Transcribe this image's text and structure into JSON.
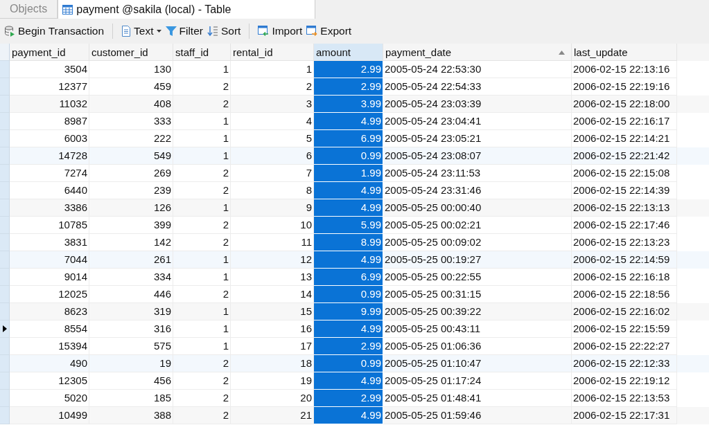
{
  "tabs": [
    {
      "label": "Objects",
      "selected": false,
      "kind": "objects"
    },
    {
      "label": "payment @sakila (local) - Table",
      "selected": true,
      "kind": "table"
    }
  ],
  "toolbar": [
    {
      "label": "Begin Transaction",
      "kind": "transaction"
    },
    {
      "label": "Text",
      "kind": "text"
    },
    {
      "label": "Filter",
      "kind": "filter"
    },
    {
      "label": "Sort",
      "kind": "sort"
    },
    {
      "label": "Import",
      "kind": "import"
    },
    {
      "label": "Export",
      "kind": "export"
    }
  ],
  "table": {
    "columns": [
      {
        "name": "payment_id",
        "kind": "number",
        "selected": false,
        "sorted": false
      },
      {
        "name": "customer_id",
        "kind": "number",
        "selected": false,
        "sorted": false
      },
      {
        "name": "staff_id",
        "kind": "number",
        "selected": false,
        "sorted": false
      },
      {
        "name": "rental_id",
        "kind": "number",
        "selected": false,
        "sorted": false
      },
      {
        "name": "amount",
        "kind": "number",
        "selected": true,
        "sorted": false
      },
      {
        "name": "payment_date",
        "kind": "datetime",
        "selected": false,
        "sorted": true
      },
      {
        "name": "last_update",
        "kind": "datetime",
        "selected": false,
        "sorted": false
      }
    ],
    "rows": [
      {
        "current": false,
        "cells": [
          "3504",
          "130",
          "1",
          "1",
          "2.99",
          "2005-05-24 22:53:30",
          "2006-02-15 22:13:16"
        ]
      },
      {
        "current": false,
        "cells": [
          "12377",
          "459",
          "2",
          "2",
          "2.99",
          "2005-05-24 22:54:33",
          "2006-02-15 22:19:16"
        ]
      },
      {
        "current": false,
        "cells": [
          "11032",
          "408",
          "2",
          "3",
          "3.99",
          "2005-05-24 23:03:39",
          "2006-02-15 22:18:00"
        ]
      },
      {
        "current": false,
        "cells": [
          "8987",
          "333",
          "1",
          "4",
          "4.99",
          "2005-05-24 23:04:41",
          "2006-02-15 22:16:17"
        ]
      },
      {
        "current": false,
        "cells": [
          "6003",
          "222",
          "1",
          "5",
          "6.99",
          "2005-05-24 23:05:21",
          "2006-02-15 22:14:21"
        ]
      },
      {
        "current": false,
        "cells": [
          "14728",
          "549",
          "1",
          "6",
          "0.99",
          "2005-05-24 23:08:07",
          "2006-02-15 22:21:42"
        ]
      },
      {
        "current": false,
        "cells": [
          "7274",
          "269",
          "2",
          "7",
          "1.99",
          "2005-05-24 23:11:53",
          "2006-02-15 22:15:08"
        ]
      },
      {
        "current": false,
        "cells": [
          "6440",
          "239",
          "2",
          "8",
          "4.99",
          "2005-05-24 23:31:46",
          "2006-02-15 22:14:39"
        ]
      },
      {
        "current": false,
        "cells": [
          "3386",
          "126",
          "1",
          "9",
          "4.99",
          "2005-05-25 00:00:40",
          "2006-02-15 22:13:13"
        ]
      },
      {
        "current": false,
        "cells": [
          "10785",
          "399",
          "2",
          "10",
          "5.99",
          "2005-05-25 00:02:21",
          "2006-02-15 22:17:46"
        ]
      },
      {
        "current": false,
        "cells": [
          "3831",
          "142",
          "2",
          "11",
          "8.99",
          "2005-05-25 00:09:02",
          "2006-02-15 22:13:23"
        ]
      },
      {
        "current": false,
        "cells": [
          "7044",
          "261",
          "1",
          "12",
          "4.99",
          "2005-05-25 00:19:27",
          "2006-02-15 22:14:59"
        ]
      },
      {
        "current": false,
        "cells": [
          "9014",
          "334",
          "1",
          "13",
          "6.99",
          "2005-05-25 00:22:55",
          "2006-02-15 22:16:18"
        ]
      },
      {
        "current": false,
        "cells": [
          "12025",
          "446",
          "2",
          "14",
          "0.99",
          "2005-05-25 00:31:15",
          "2006-02-15 22:18:56"
        ]
      },
      {
        "current": false,
        "cells": [
          "8623",
          "319",
          "1",
          "15",
          "9.99",
          "2005-05-25 00:39:22",
          "2006-02-15 22:16:02"
        ]
      },
      {
        "current": true,
        "cells": [
          "8554",
          "316",
          "1",
          "16",
          "4.99",
          "2005-05-25 00:43:11",
          "2006-02-15 22:15:59"
        ]
      },
      {
        "current": false,
        "cells": [
          "15394",
          "575",
          "1",
          "17",
          "2.99",
          "2005-05-25 01:06:36",
          "2006-02-15 22:22:27"
        ]
      },
      {
        "current": false,
        "cells": [
          "490",
          "19",
          "2",
          "18",
          "0.99",
          "2005-05-25 01:10:47",
          "2006-02-15 22:12:33"
        ]
      },
      {
        "current": false,
        "cells": [
          "12305",
          "456",
          "2",
          "19",
          "4.99",
          "2005-05-25 01:17:24",
          "2006-02-15 22:19:12"
        ]
      },
      {
        "current": false,
        "cells": [
          "5020",
          "185",
          "2",
          "20",
          "2.99",
          "2005-05-25 01:48:41",
          "2006-02-15 22:13:53"
        ]
      },
      {
        "current": false,
        "cells": [
          "10499",
          "388",
          "2",
          "21",
          "4.99",
          "2005-05-25 01:59:46",
          "2006-02-15 22:17:31"
        ]
      }
    ]
  }
}
